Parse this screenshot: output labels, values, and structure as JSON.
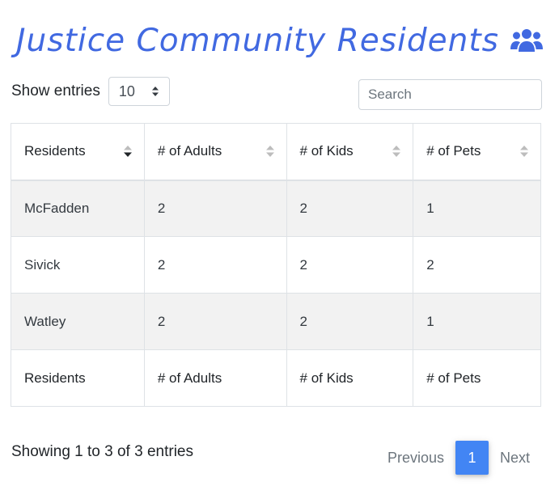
{
  "page": {
    "title": "Justice Community Residents",
    "title_icon": "users-icon",
    "accent_color": "#4169e1"
  },
  "controls": {
    "show_label": "Show entries",
    "page_size": "10",
    "search_placeholder": "Search"
  },
  "table": {
    "columns": [
      "Residents",
      "# of Adults",
      "# of Kids",
      "# of Pets"
    ],
    "rows": [
      [
        "McFadden",
        "2",
        "2",
        "1"
      ],
      [
        "Sivick",
        "2",
        "2",
        "2"
      ],
      [
        "Watley",
        "2",
        "2",
        "1"
      ]
    ],
    "footer": [
      "Residents",
      "# of Adults",
      "# of Kids",
      "# of Pets"
    ],
    "sorted_column": "Residents",
    "sort_direction": "ascending"
  },
  "footer": {
    "info": "Showing 1 to 3 of 3 entries",
    "previous_label": "Previous",
    "current_page": "1",
    "next_label": "Next",
    "current_page_color": "#4285f4"
  }
}
